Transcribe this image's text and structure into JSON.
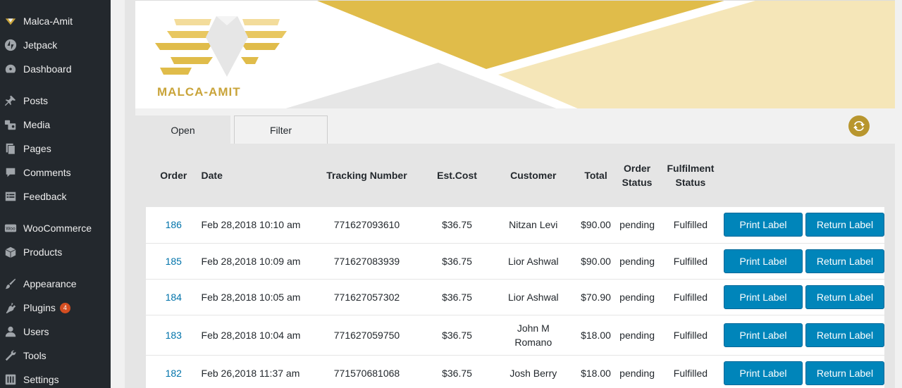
{
  "sidebar": {
    "items": [
      {
        "label": "Malca-Amit",
        "icon": "malca-amit-logo-icon"
      },
      {
        "label": "Jetpack",
        "icon": "jetpack-icon"
      },
      {
        "label": "Dashboard",
        "icon": "dashboard-icon"
      },
      {
        "label": "Posts",
        "icon": "pin-icon"
      },
      {
        "label": "Media",
        "icon": "media-icon"
      },
      {
        "label": "Pages",
        "icon": "pages-icon"
      },
      {
        "label": "Comments",
        "icon": "comment-icon"
      },
      {
        "label": "Feedback",
        "icon": "feedback-icon"
      },
      {
        "label": "WooCommerce",
        "icon": "woocommerce-icon"
      },
      {
        "label": "Products",
        "icon": "box-icon"
      },
      {
        "label": "Appearance",
        "icon": "brush-icon"
      },
      {
        "label": "Plugins",
        "icon": "plugin-icon",
        "badge": "4"
      },
      {
        "label": "Users",
        "icon": "user-icon"
      },
      {
        "label": "Tools",
        "icon": "wrench-icon"
      },
      {
        "label": "Settings",
        "icon": "settings-icon"
      }
    ]
  },
  "banner": {
    "brand": "MALCA-AMIT",
    "colors": {
      "gold": "#e0bc4a",
      "light_gold": "#f5e6b8",
      "grey": "#e6e6e6"
    }
  },
  "tabs": {
    "open": "Open",
    "filter": "Filter"
  },
  "refresh_icon": "refresh-icon",
  "table": {
    "headers": {
      "order": "Order",
      "date": "Date",
      "tracking": "Tracking Number",
      "est_cost": "Est.Cost",
      "customer": "Customer",
      "total": "Total",
      "order_status_1": "Order",
      "order_status_2": "Status",
      "fulfilment_1": "Fulfilment",
      "fulfilment_2": "Status"
    },
    "print_label": "Print Label",
    "return_label": "Return Label",
    "rows": [
      {
        "order": "186",
        "date": "Feb 28,2018 10:10 am",
        "tracking": "771627093610",
        "est_cost": "$36.75",
        "customer": "Nitzan Levi",
        "total": "$90.00",
        "status": "pending",
        "fulfilment": "Fulfilled"
      },
      {
        "order": "185",
        "date": "Feb 28,2018 10:09 am",
        "tracking": "771627083939",
        "est_cost": "$36.75",
        "customer": "Lior Ashwal",
        "total": "$90.00",
        "status": "pending",
        "fulfilment": "Fulfilled"
      },
      {
        "order": "184",
        "date": "Feb 28,2018 10:05 am",
        "tracking": "771627057302",
        "est_cost": "$36.75",
        "customer": "Lior Ashwal",
        "total": "$70.90",
        "status": "pending",
        "fulfilment": "Fulfilled"
      },
      {
        "order": "183",
        "date": "Feb 28,2018 10:04 am",
        "tracking": "771627059750",
        "est_cost": "$36.75",
        "customer": "John M Romano",
        "total": "$18.00",
        "status": "pending",
        "fulfilment": "Fulfilled"
      },
      {
        "order": "182",
        "date": "Feb 26,2018 11:37 am",
        "tracking": "771570681068",
        "est_cost": "$36.75",
        "customer": "Josh Berry",
        "total": "$18.00",
        "status": "pending",
        "fulfilment": "Fulfilled"
      }
    ]
  }
}
